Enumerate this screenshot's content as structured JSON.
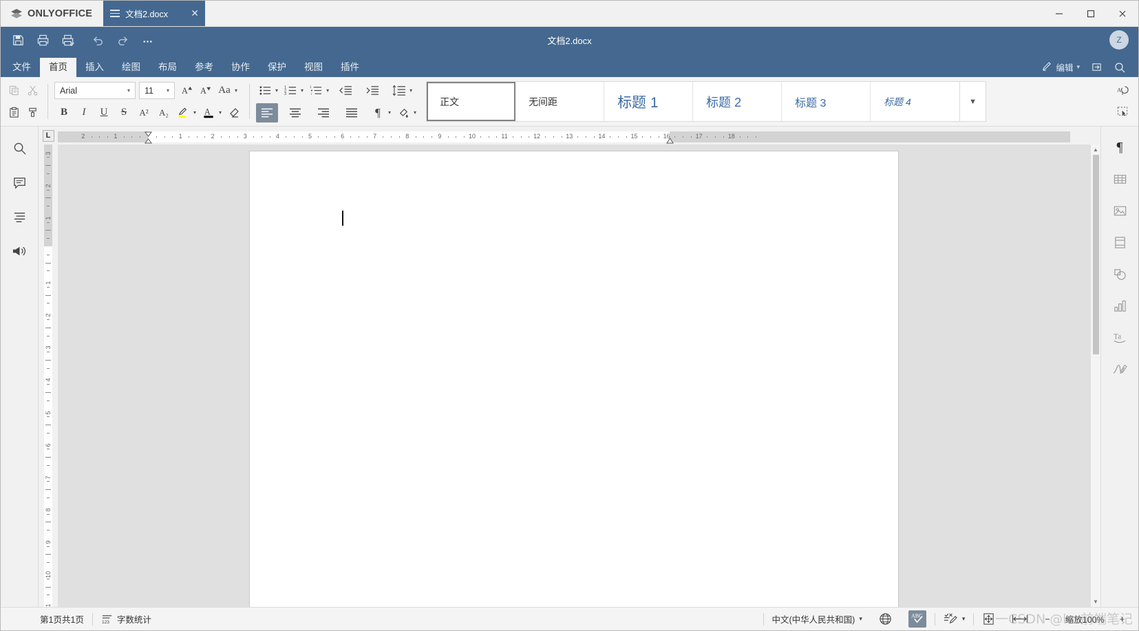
{
  "window": {
    "brand": "ONLYOFFICE",
    "tab_title": "文档2.docx",
    "tab_close": "✕",
    "minimize": "minimize-icon",
    "maximize": "maximize-icon",
    "close": "close-icon"
  },
  "header": {
    "doc_title": "文档2.docx",
    "avatar_initial": "Z",
    "quick_access": [
      {
        "name": "save-button",
        "icon": "save-icon"
      },
      {
        "name": "print-button",
        "icon": "print-icon"
      },
      {
        "name": "quick-print-button",
        "icon": "quick-print-icon"
      },
      {
        "name": "undo-button",
        "icon": "undo-icon"
      },
      {
        "name": "redo-button",
        "icon": "redo-icon"
      },
      {
        "name": "more-button",
        "icon": "ellipsis-icon"
      }
    ],
    "tabs": [
      {
        "label": "文件",
        "active": false
      },
      {
        "label": "首页",
        "active": true
      },
      {
        "label": "插入",
        "active": false
      },
      {
        "label": "绘图",
        "active": false
      },
      {
        "label": "布局",
        "active": false
      },
      {
        "label": "参考",
        "active": false
      },
      {
        "label": "协作",
        "active": false
      },
      {
        "label": "保护",
        "active": false
      },
      {
        "label": "视图",
        "active": false
      },
      {
        "label": "插件",
        "active": false
      }
    ],
    "edit_mode_label": "编辑",
    "open_location_icon": "open-file-location-icon",
    "search_icon": "search-icon"
  },
  "toolbar": {
    "copy_icon": "copy-icon",
    "cut_icon": "cut-icon",
    "paste_icon": "paste-icon",
    "format_painter_icon": "format-painter-icon",
    "font_name": "Arial",
    "font_size": "11",
    "increase_font_icon": "increase-font-size-icon",
    "decrease_font_icon": "decrease-font-size-icon",
    "change_case_label": "Aa",
    "bold_label": "B",
    "italic_label": "I",
    "underline_label": "U",
    "strikeout_label": "S",
    "superscript_label": "A²",
    "subscript_label": "A₂",
    "highlight_icon": "highlight-color-icon",
    "font_color_label": "A",
    "clear_style_icon": "clear-style-icon",
    "bullets_icon": "bullet-list-icon",
    "numbering_icon": "numbered-list-icon",
    "multilevel_icon": "multilevel-list-icon",
    "decrease_indent_icon": "decrease-indent-icon",
    "increase_indent_icon": "increase-indent-icon",
    "line_spacing_icon": "line-spacing-icon",
    "align_left_icon": "align-left-icon",
    "align_center_icon": "align-center-icon",
    "align_right_icon": "align-right-icon",
    "align_justify_icon": "align-justify-icon",
    "show_marks_icon": "paragraph-marks-icon",
    "shading_icon": "shading-color-icon",
    "copy_style_icon": "copy-style-icon",
    "select_all_icon": "select-all-icon",
    "styles_expand_icon": "chevron-down-icon",
    "styles": [
      {
        "label": "正文",
        "class": "normal",
        "active": true
      },
      {
        "label": "无间距",
        "class": "nospacing",
        "active": false
      },
      {
        "label": "标题 1",
        "class": "h1",
        "active": false
      },
      {
        "label": "标题 2",
        "class": "h2",
        "active": false
      },
      {
        "label": "标题 3",
        "class": "h3",
        "active": false
      },
      {
        "label": "标题 4",
        "class": "h4",
        "active": false
      }
    ]
  },
  "left_sidebar": [
    {
      "name": "sidebar-search",
      "icon": "search-icon"
    },
    {
      "name": "sidebar-comments",
      "icon": "comment-icon"
    },
    {
      "name": "sidebar-navigation",
      "icon": "headings-icon"
    },
    {
      "name": "sidebar-feedback",
      "icon": "megaphone-icon"
    }
  ],
  "right_sidebar": [
    {
      "name": "right-paragraph-settings",
      "icon": "paragraph-icon",
      "active": true
    },
    {
      "name": "right-table-settings",
      "icon": "table-icon",
      "active": false
    },
    {
      "name": "right-image-settings",
      "icon": "image-icon",
      "active": false
    },
    {
      "name": "right-header-footer-settings",
      "icon": "header-footer-icon",
      "active": false
    },
    {
      "name": "right-shape-settings",
      "icon": "shape-icon",
      "active": false
    },
    {
      "name": "right-chart-settings",
      "icon": "chart-icon",
      "active": false
    },
    {
      "name": "right-text-art-settings",
      "icon": "text-art-icon",
      "active": false
    },
    {
      "name": "right-signature-settings",
      "icon": "signature-icon",
      "active": false
    }
  ],
  "ruler": {
    "tab_selector_label": "L",
    "h_numbers": [
      "2",
      "1",
      "1",
      "2",
      "3",
      "4",
      "5",
      "6",
      "7",
      "8",
      "9",
      "10",
      "11",
      "12",
      "13",
      "14",
      "15",
      "16",
      "17"
    ],
    "v_numbers": [
      "1",
      "1",
      "2",
      "3",
      "4",
      "5",
      "6",
      "7",
      "8",
      "9",
      "10",
      "11"
    ]
  },
  "statusbar": {
    "page_count": "第1页共1页",
    "word_count": "字数统计",
    "word_count_icon": "word-count-icon",
    "language": "中文(中华人民共和国)",
    "language_icon": "globe-icon",
    "spellcheck_icon": "spellcheck-icon",
    "track_changes_icon": "track-changes-icon",
    "fit_page_icon": "fit-to-page-icon",
    "fit_width_icon": "fit-to-width-icon",
    "zoom_label": "缩放100%",
    "zoom_out": "−",
    "zoom_in": "+"
  },
  "watermark": "一CSDN @lcz前端笔记"
}
